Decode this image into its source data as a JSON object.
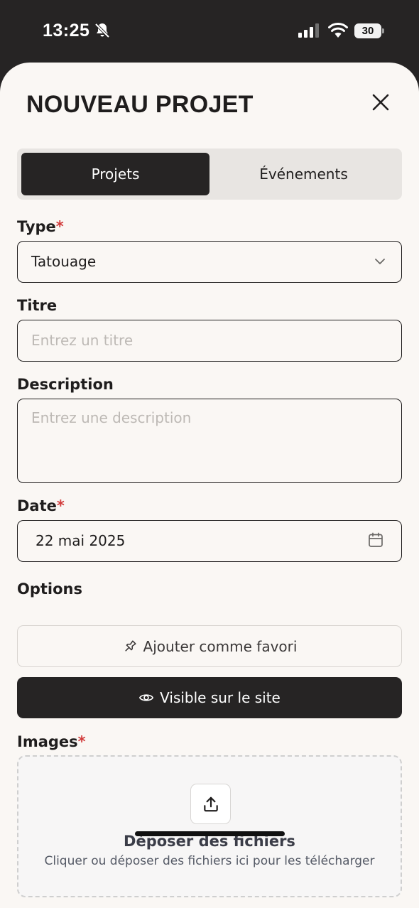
{
  "status_bar": {
    "time": "13:25",
    "battery": "30"
  },
  "header": {
    "title": "NOUVEAU PROJET"
  },
  "tabs": [
    {
      "label": "Projets",
      "active": true
    },
    {
      "label": "Événements",
      "active": false
    }
  ],
  "form": {
    "type": {
      "label": "Type",
      "required_mark": "*",
      "value": "Tatouage"
    },
    "title": {
      "label": "Titre",
      "placeholder": "Entrez un titre",
      "value": ""
    },
    "description": {
      "label": "Description",
      "placeholder": "Entrez une description",
      "value": ""
    },
    "date": {
      "label": "Date",
      "required_mark": "*",
      "value": "22 mai 2025"
    },
    "options": {
      "label": "Options",
      "favorite_label": "Ajouter comme favori",
      "visible_label": "Visible sur le site"
    },
    "images": {
      "label": "Images",
      "required_mark": "*",
      "drop_title": "Déposer des fichiers",
      "drop_subtitle": "Cliquer ou déposer des fichiers ici pour les télécharger"
    }
  },
  "icons": [
    "bell-slash-icon",
    "signal-icon",
    "wifi-icon",
    "close-icon",
    "chevron-down-icon",
    "calendar-icon",
    "pin-icon",
    "eye-icon",
    "upload-icon"
  ],
  "colors": {
    "dark": "#262424",
    "background": "#faf7f4",
    "required": "#d23b3b",
    "placeholder": "#bdb9b5"
  }
}
